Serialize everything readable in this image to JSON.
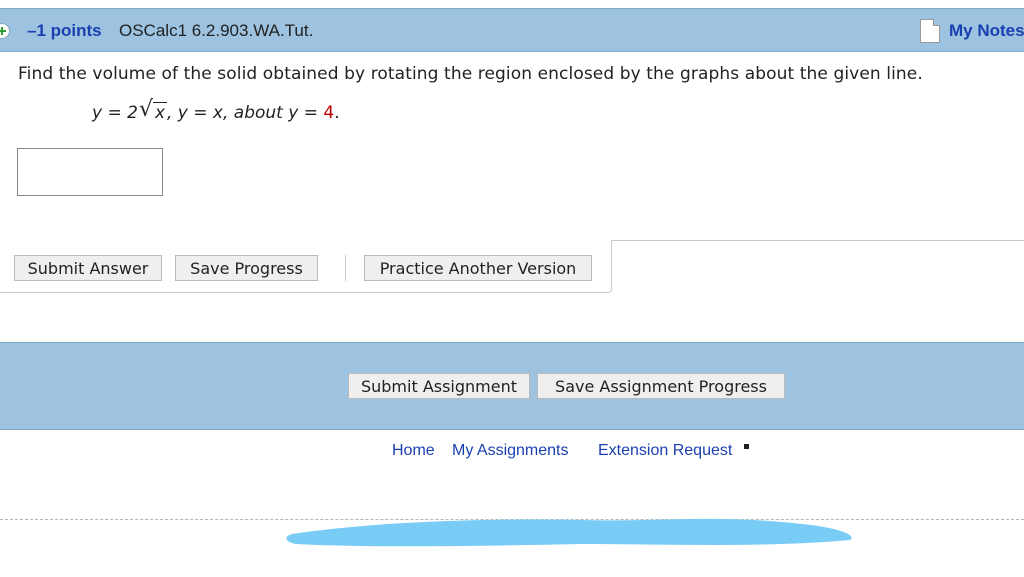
{
  "header": {
    "points": "–1 points",
    "question_code": "OSCalc1 6.2.903.WA.Tut.",
    "my_notes": "My Notes"
  },
  "question": {
    "prompt": "Find the volume of the solid obtained by rotating the region enclosed by the graphs about the given line.",
    "eq_part1": "y = 2",
    "eq_radicand": "x",
    "eq_part2": ", y = x, about y = ",
    "eq_value": "4",
    "eq_end": "."
  },
  "answer": {
    "value": "",
    "placeholder": ""
  },
  "buttons": {
    "submit_answer": "Submit Answer",
    "save_progress": "Save Progress",
    "practice_another": "Practice Another Version"
  },
  "assignment_buttons": {
    "submit_assignment": "Submit Assignment",
    "save_assignment_progress": "Save Assignment Progress"
  },
  "footer": {
    "home": "Home",
    "my_assignments": "My Assignments",
    "extension_request": "Extension Request"
  },
  "colors": {
    "bar_bg": "#9dc3e0",
    "link": "#1a3fb0",
    "highlight_value": "#c00000",
    "redaction": "#79ccf5"
  },
  "icons": [
    "plus-icon",
    "note-icon",
    "external-link-icon"
  ]
}
